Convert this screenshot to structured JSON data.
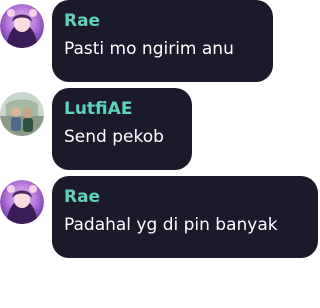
{
  "messages": [
    {
      "author": "Rae",
      "text": "Pasti mo ngirim anu",
      "avatar_icon": "rae-avatar-icon"
    },
    {
      "author": "LutfiAE",
      "text": "Send pekob",
      "avatar_icon": "lutfiae-avatar-icon"
    },
    {
      "author": "Rae",
      "text": "Padahal yg di pin banyak",
      "avatar_icon": "rae-avatar-icon"
    }
  ],
  "colors": {
    "bubble_bg": "#1b1a2b",
    "name": "#5fd3b9",
    "text": "#ffffff",
    "page_bg": "#ffffff"
  }
}
